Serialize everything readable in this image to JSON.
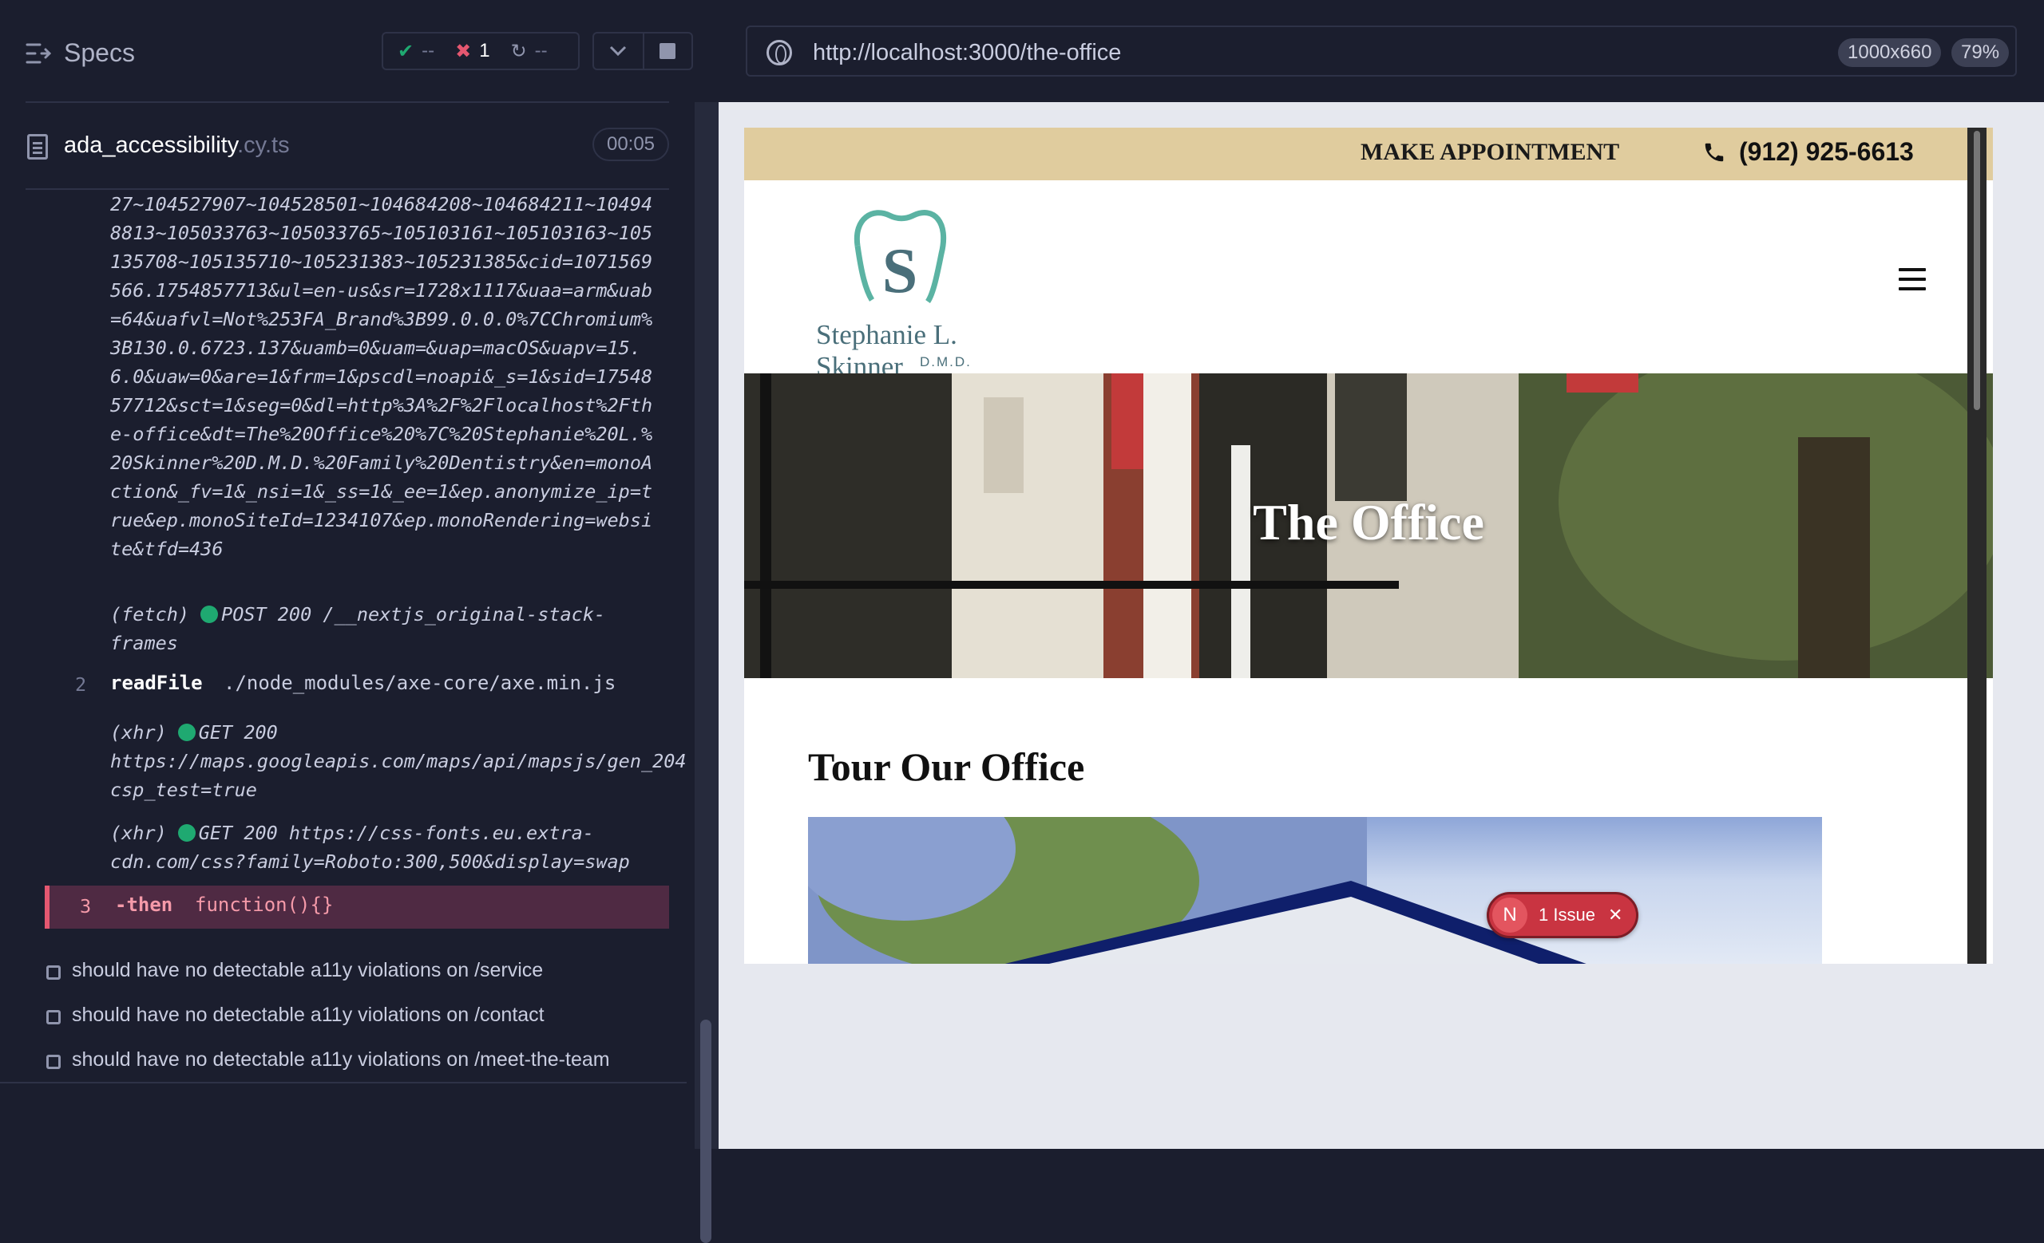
{
  "reporter": {
    "specs_label": "Specs",
    "stats": {
      "passed": "--",
      "failed": "1",
      "pending": "--"
    },
    "spec_file": {
      "name": "ada_accessibility",
      "ext": ".cy.ts",
      "duration": "00:05"
    },
    "log": {
      "url_continuation": "27~104527907~104528501~104684208~104684211~104948813~105033763~105033765~105103161~105103163~105135708~105135710~105231383~105231385&cid=1071569566.1754857713&ul=en-us&sr=1728x1117&uaa=arm&uab=64&uafvl=Not%253FA_Brand%3B99.0.0.0%7CChromium%3B130.0.6723.137&uamb=0&uam=&uap=macOS&uapv=15.6.0&uaw=0&are=1&frm=1&pscdl=noapi&_s=1&sid=1754857712&sct=1&seg=0&dl=http%3A%2F%2Flocalhost%2Fthe-office&dt=The%20Office%20%7C%20Stephanie%20L.%20Skinner%20D.M.D.%20Family%20Dentistry&en=monoAction&_fv=1&_nsi=1&_ss=1&_ee=1&ep.anonymize_ip=true&ep.monoSiteId=1234107&ep.monoRendering=website&tfd=436",
      "fetch": {
        "kind": "(fetch)",
        "status": "POST 200 /__nextjs_original-stack-frames"
      },
      "cmd2": {
        "num": "2",
        "name": "readFile",
        "arg": "./node_modules/axe-core/axe.min.js"
      },
      "xhr1": {
        "kind": "(xhr)",
        "status": "GET 200 https://maps.googleapis.com/maps/api/mapsjs/gen_204?csp_test=true"
      },
      "xhr2": {
        "kind": "(xhr)",
        "status": "GET 200 https://css-fonts.eu.extra-cdn.com/css?family=Roboto:300,500&display=swap"
      },
      "cmd3": {
        "num": "3",
        "name": "-then",
        "arg": "function(){}"
      }
    },
    "tests": [
      "should have no detectable a11y violations on /service",
      "should have no detectable a11y violations on /contact",
      "should have no detectable a11y violations on /meet-the-team"
    ]
  },
  "browser": {
    "url": "http://localhost:3000/the-office",
    "viewport": "1000x660",
    "zoom": "79%"
  },
  "site": {
    "make_appointment": "MAKE APPOINTMENT",
    "phone": "(912) 925-6613",
    "logo_name": "Stephanie L. Skinner",
    "logo_degree": "D.M.D.",
    "hero_title": "The Office",
    "section_title": "Tour Our Office"
  },
  "issue_overlay": {
    "icon": "N",
    "label": "1 Issue"
  },
  "colors": {
    "panel_bg": "#1b1e2e",
    "active_command_bg": "#4f2a43",
    "top_banner": "#e0cc9e",
    "issue_red": "#c93441",
    "success_green": "#1fa971"
  }
}
